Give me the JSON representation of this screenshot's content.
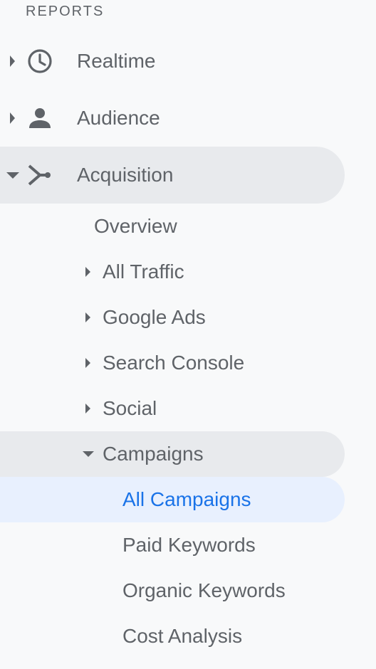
{
  "section": {
    "heading": "REPORTS"
  },
  "colors": {
    "text": "#5f6368",
    "active_text": "#1a73e8",
    "active_bg": "#e8f0fe",
    "expanded_bg": "#e8eaed",
    "sidebar_bg": "#f8f9fa"
  },
  "nav": {
    "realtime": {
      "label": "Realtime",
      "icon": "clock-icon",
      "state": "collapsed"
    },
    "audience": {
      "label": "Audience",
      "icon": "person-icon",
      "state": "collapsed"
    },
    "acquisition": {
      "label": "Acquisition",
      "icon": "acquisition-icon",
      "state": "expanded",
      "children": {
        "overview": {
          "label": "Overview"
        },
        "all_traffic": {
          "label": "All Traffic",
          "state": "collapsed"
        },
        "google_ads": {
          "label": "Google Ads",
          "state": "collapsed"
        },
        "search_console": {
          "label": "Search Console",
          "state": "collapsed"
        },
        "social": {
          "label": "Social",
          "state": "collapsed"
        },
        "campaigns": {
          "label": "Campaigns",
          "state": "expanded",
          "children": {
            "all_campaigns": {
              "label": "All Campaigns",
              "active": true
            },
            "paid_keywords": {
              "label": "Paid Keywords"
            },
            "organic_keywords": {
              "label": "Organic Keywords"
            },
            "cost_analysis": {
              "label": "Cost Analysis"
            }
          }
        }
      }
    }
  }
}
